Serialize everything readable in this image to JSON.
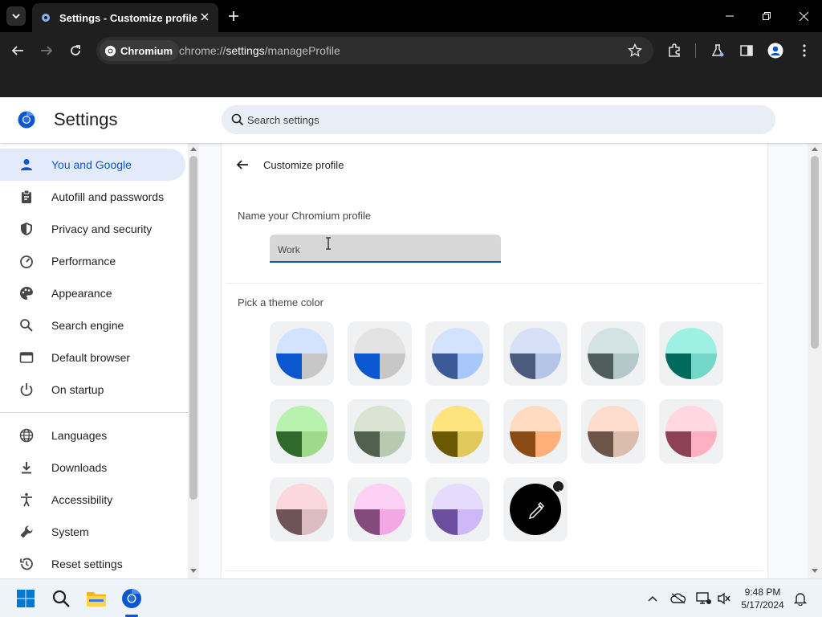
{
  "browser": {
    "tab_title": "Settings - Customize profile",
    "chip_label": "Chromium",
    "url_scheme": "chrome://",
    "url_host": "settings",
    "url_path": "/manageProfile"
  },
  "header": {
    "title": "Settings",
    "search_placeholder": "Search settings"
  },
  "sidebar": {
    "items": [
      {
        "label": "You and Google",
        "icon": "person-icon",
        "active": true
      },
      {
        "label": "Autofill and passwords",
        "icon": "clipboard-icon"
      },
      {
        "label": "Privacy and security",
        "icon": "shield-icon"
      },
      {
        "label": "Performance",
        "icon": "speedometer-icon"
      },
      {
        "label": "Appearance",
        "icon": "palette-icon"
      },
      {
        "label": "Search engine",
        "icon": "search-icon"
      },
      {
        "label": "Default browser",
        "icon": "browser-window-icon"
      },
      {
        "label": "On startup",
        "icon": "power-icon"
      },
      {
        "label": "Languages",
        "icon": "globe-icon"
      },
      {
        "label": "Downloads",
        "icon": "download-icon"
      },
      {
        "label": "Accessibility",
        "icon": "accessibility-icon"
      },
      {
        "label": "System",
        "icon": "wrench-icon"
      },
      {
        "label": "Reset settings",
        "icon": "reset-history-icon"
      }
    ]
  },
  "page": {
    "title": "Customize profile",
    "name_label": "Name your Chromium profile",
    "name_value": "Work",
    "theme_label": "Pick a theme color",
    "themes": [
      {
        "top": "#d3e3fd",
        "left": "#0b57d0",
        "right": "#c7c7c7"
      },
      {
        "top": "#e3e3e3",
        "left": "#0b57d0",
        "right": "#c7c7c7"
      },
      {
        "top": "#d3e3fd",
        "left": "#3d5a98",
        "right": "#a8c7fa"
      },
      {
        "top": "#d6e1f7",
        "left": "#4a5b7e",
        "right": "#b4c6e7"
      },
      {
        "top": "#d3e2e3",
        "left": "#4f5d5c",
        "right": "#b5c8c9"
      },
      {
        "top": "#9ef0e2",
        "left": "#006a5d",
        "right": "#74d6c7"
      },
      {
        "top": "#b9f2ae",
        "left": "#2f6a2a",
        "right": "#9ed98c"
      },
      {
        "top": "#d9e4d2",
        "left": "#52604e",
        "right": "#b8c9b2"
      },
      {
        "top": "#fde47f",
        "left": "#6b5800",
        "right": "#e0c85a"
      },
      {
        "top": "#ffdcc1",
        "left": "#8a4b14",
        "right": "#ffb07a"
      },
      {
        "top": "#fddccd",
        "left": "#6d5448",
        "right": "#dcbcac"
      },
      {
        "top": "#ffd8e2",
        "left": "#8c4154",
        "right": "#ffafc1"
      },
      {
        "top": "#fad8dc",
        "left": "#6f5457",
        "right": "#dbbdc0"
      },
      {
        "top": "#fcd0f5",
        "left": "#844a7c",
        "right": "#f2a9e3"
      },
      {
        "top": "#e6dbfd",
        "left": "#6c4e9e",
        "right": "#cfb8f7"
      }
    ],
    "custom_selected": true
  },
  "taskbar": {
    "time": "9:48 PM",
    "date": "5/17/2024"
  }
}
